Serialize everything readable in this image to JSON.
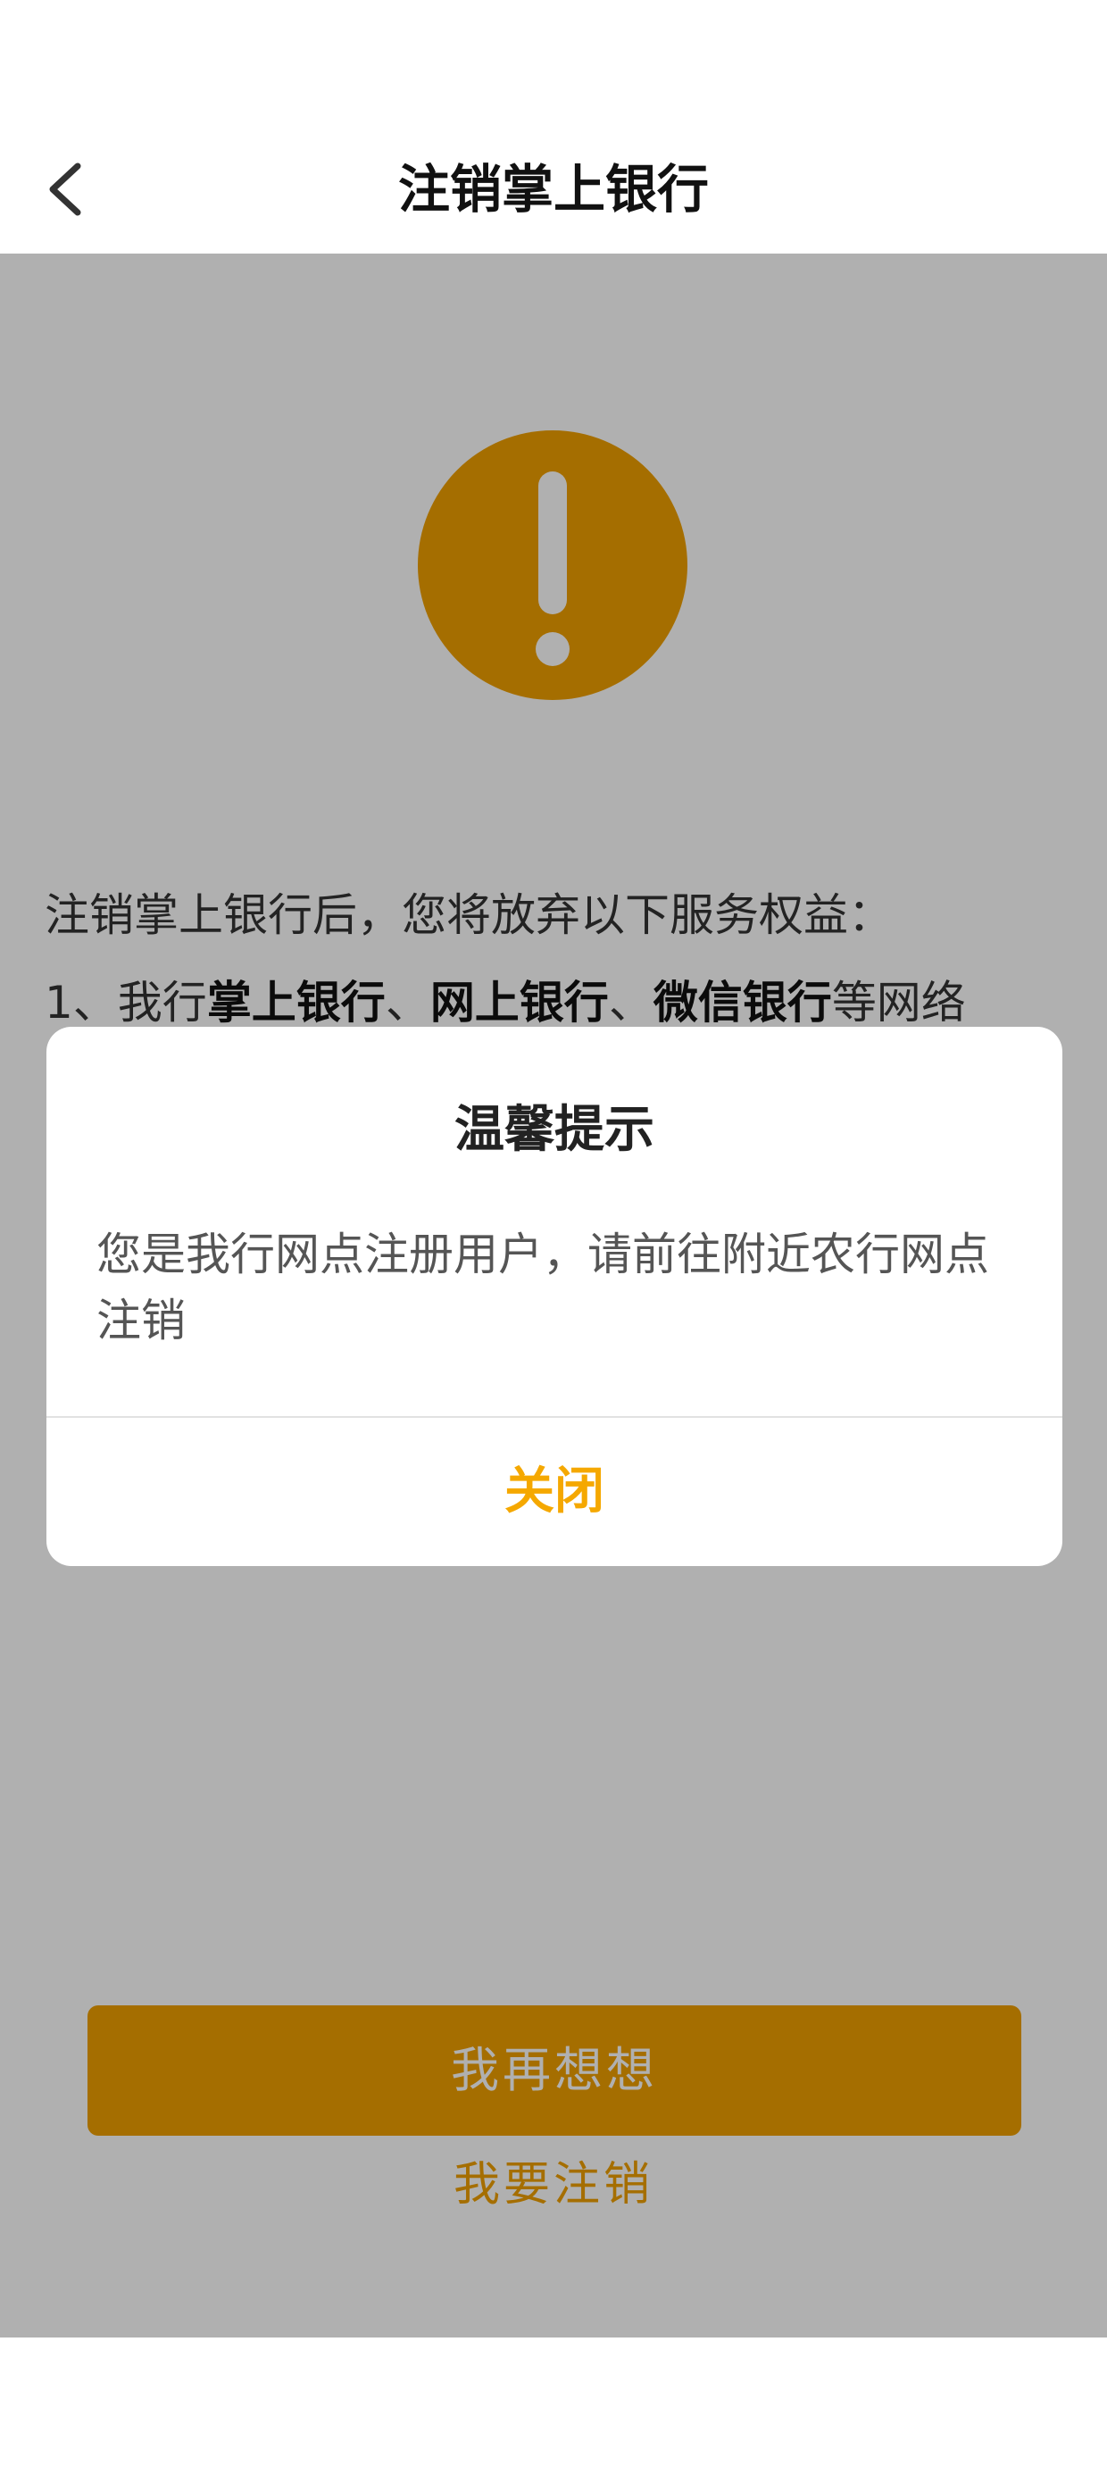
{
  "header": {
    "title": "注销掌上银行",
    "back_icon": "chevron-left-icon"
  },
  "content": {
    "warning_icon": "exclamation-circle-icon",
    "intro": "注销掌上银行后，您将放弃以下服务权益：",
    "list_item_1": {
      "prefix": "1、我行",
      "bold_1": "掌上银行",
      "sep_1": "、",
      "bold_2": "网上银行",
      "sep_2": "、",
      "bold_3": "微信银行",
      "suffix": "等网络"
    },
    "primary_button": "我再想想",
    "secondary_link": "我要注销"
  },
  "dialog": {
    "title": "温馨提示",
    "message": "您是我行网点注册用户，请前往附近农行网点注销",
    "close_button": "关闭"
  },
  "colors": {
    "accent": "#f0a000",
    "dialog_button": "#f5a800"
  }
}
